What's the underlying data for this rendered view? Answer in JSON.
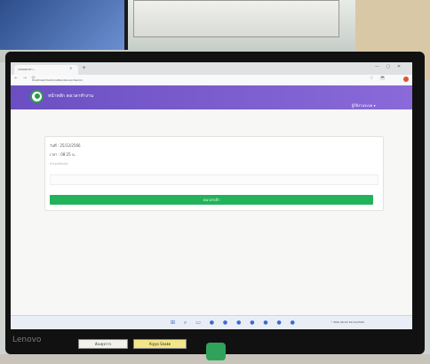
{
  "browser": {
    "tab_title": "ระบบลงเวลา ... ",
    "tab_close": "×",
    "new_tab": "+",
    "url": "localhost/checkin/attendance/checkin",
    "nav_icons": "← → ⟳",
    "ext_icons": "☆ ⬒",
    "window_controls": "— ▢ ✕"
  },
  "header": {
    "app_title": "หน้าหลัก  ลงเวลาทำงาน",
    "user_menu": "ผู้ใช้งานระบบ ▾"
  },
  "card": {
    "line1": "วันที่ : 25/12/2566",
    "line2": "เวลา : 08:25 น.",
    "line3": "ตำแหน่งปัจจุบัน"
  },
  "checkin_button": "ลงเวลาเข้า",
  "taskbar": {
    "icons": "⊞ ⌕ ▭ ● ● ● ● ● ● ●",
    "tray": "^ ENG 08:25 25/12/2566"
  },
  "desk": {
    "brand": "Lenovo",
    "label1": "ห้องธุรการ",
    "label2": "Aiyyo Snake"
  },
  "colors": {
    "header": "#7b5fd0",
    "button": "#22b35a"
  }
}
